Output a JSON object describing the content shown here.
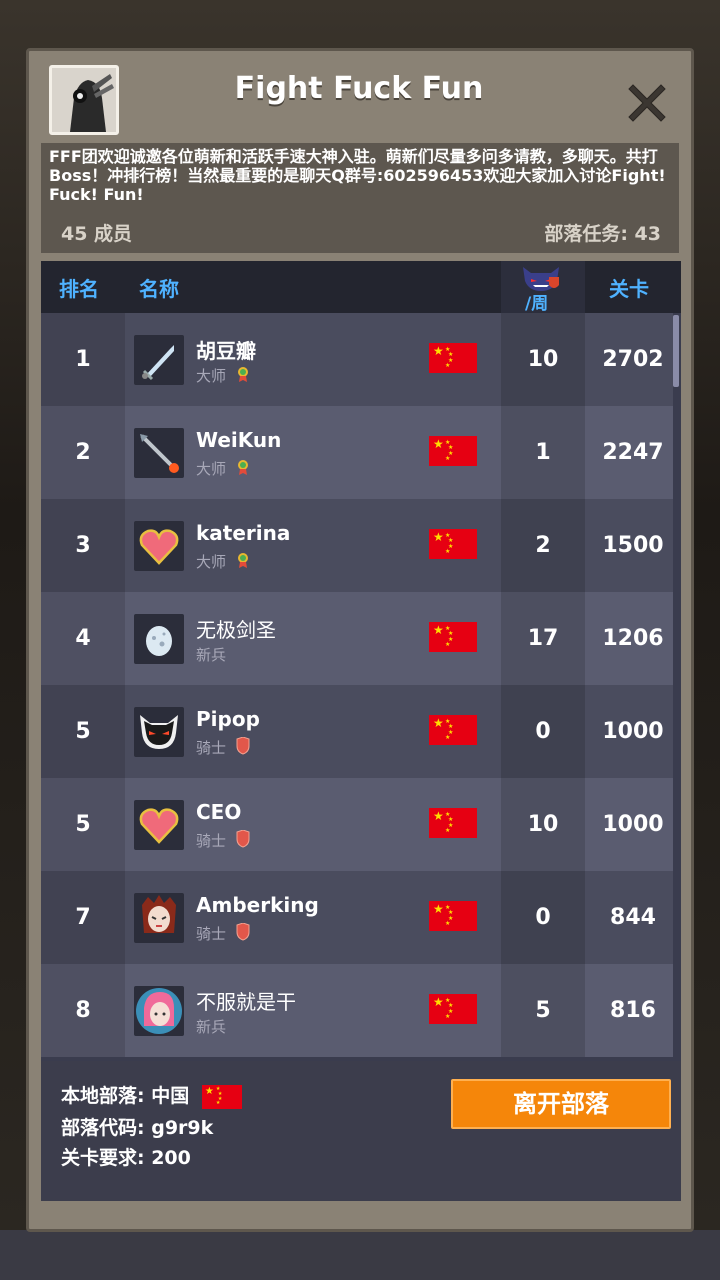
{
  "clan": {
    "name": "Fight Fuck Fun",
    "description": "FFF团欢迎诚邀各位萌新和活跃手速大神入驻。萌新们尽量多问多请教，多聊天。共打Boss！冲排行榜！当然最重要的是聊天Q群号:602596453欢迎大家加入讨论Fight! Fuck! Fun!",
    "members_label": "45 成员",
    "tasks_label": "部落任务: 43"
  },
  "table": {
    "headers": {
      "rank": "排名",
      "name": "名称",
      "week": "/周",
      "stage": "关卡"
    },
    "rows": [
      {
        "rank": "1",
        "name": "胡豆瓣",
        "title": "大师",
        "week": "10",
        "stage": "2702",
        "icon": "sword-icon",
        "badge": "medal-icon"
      },
      {
        "rank": "2",
        "name": "WeiKun",
        "title": "大师",
        "week": "1",
        "stage": "2247",
        "icon": "arrow-icon",
        "badge": "medal-icon"
      },
      {
        "rank": "3",
        "name": "katerina",
        "title": "大师",
        "week": "2",
        "stage": "1500",
        "icon": "heart-icon",
        "badge": "medal-icon"
      },
      {
        "rank": "4",
        "name": "无极剑圣",
        "title": "新兵",
        "week": "17",
        "stage": "1206",
        "icon": "egg-icon",
        "badge": ""
      },
      {
        "rank": "5",
        "name": "Pipop",
        "title": "骑士",
        "week": "0",
        "stage": "1000",
        "icon": "devil-icon",
        "badge": "shield-icon"
      },
      {
        "rank": "5",
        "name": "CEO",
        "title": "骑士",
        "week": "10",
        "stage": "1000",
        "icon": "heart-icon",
        "badge": "shield-icon"
      },
      {
        "rank": "7",
        "name": "Amberking",
        "title": "骑士",
        "week": "0",
        "stage": "844",
        "icon": "girl-dark-icon",
        "badge": "shield-icon"
      },
      {
        "rank": "8",
        "name": "不服就是干",
        "title": "新兵",
        "week": "5",
        "stage": "816",
        "icon": "girl-pink-icon",
        "badge": ""
      }
    ]
  },
  "footer": {
    "region": "本地部落: 中国",
    "code": "部落代码: g9r9k",
    "requirement": "关卡要求: 200",
    "leave_button": "离开部落"
  },
  "colors": {
    "accent": "#4fb2ff",
    "button": "#f5860a"
  }
}
